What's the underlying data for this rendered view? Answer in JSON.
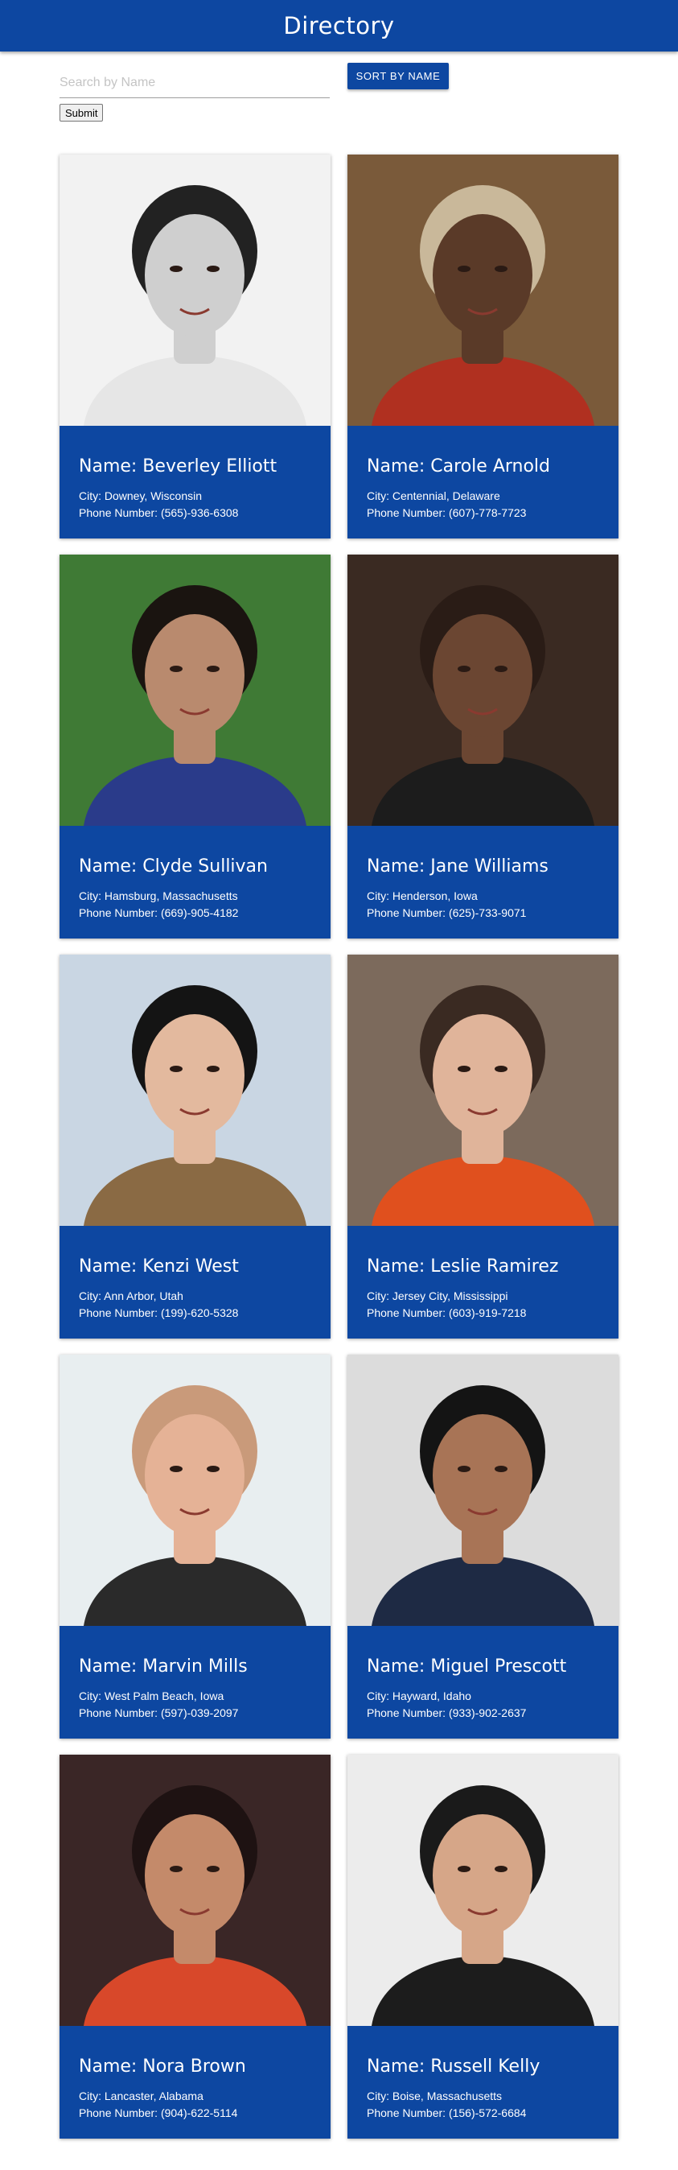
{
  "header": {
    "title": "Directory"
  },
  "search": {
    "placeholder": "Search by Name",
    "value": "",
    "submit_label": "Submit"
  },
  "sort": {
    "label": "SORT BY NAME"
  },
  "colors": {
    "brand": "#0d47a1",
    "page_bg": "#ffffff"
  },
  "people": [
    {
      "name": "Name: Beverley Elliott",
      "city": "City: Downey, Wisconsin",
      "phone": "Phone Number: (565)-936-6308",
      "photo": {
        "bg": "#f2f2f2",
        "skin": "#cfcfcf",
        "hair": "#222222",
        "shirt": "#e6e6e6"
      }
    },
    {
      "name": "Name: Carole Arnold",
      "city": "City: Centennial, Delaware",
      "phone": "Phone Number: (607)-778-7723",
      "photo": {
        "bg": "#7a5a3a",
        "skin": "#5a3a28",
        "hair": "#c9b89a",
        "shirt": "#b03020"
      }
    },
    {
      "name": "Name: Clyde Sullivan",
      "city": "City: Hamsburg, Massachusetts",
      "phone": "Phone Number: (669)-905-4182",
      "photo": {
        "bg": "#3f7a35",
        "skin": "#b98a6e",
        "hair": "#1a1410",
        "shirt": "#2a3b8a"
      }
    },
    {
      "name": "Name: Jane Williams",
      "city": "City: Henderson, Iowa",
      "phone": "Phone Number: (625)-733-9071",
      "photo": {
        "bg": "#3a2a22",
        "skin": "#6b4632",
        "hair": "#2a1c16",
        "shirt": "#1c1c1c"
      }
    },
    {
      "name": "Name: Kenzi West",
      "city": "City: Ann Arbor, Utah",
      "phone": "Phone Number: (199)-620-5328",
      "photo": {
        "bg": "#c9d6e3",
        "skin": "#e3b99e",
        "hair": "#141414",
        "shirt": "#8a6a44"
      }
    },
    {
      "name": "Name: Leslie Ramirez",
      "city": "City: Jersey City, Mississippi",
      "phone": "Phone Number: (603)-919-7218",
      "photo": {
        "bg": "#7c6a5c",
        "skin": "#e0b49a",
        "hair": "#3a2a22",
        "shirt": "#e0501e"
      }
    },
    {
      "name": "Name: Marvin Mills",
      "city": "City: West Palm Beach, Iowa",
      "phone": "Phone Number: (597)-039-2097",
      "photo": {
        "bg": "#e8eef0",
        "skin": "#e5b296",
        "hair": "#c99a7a",
        "shirt": "#2a2a2a"
      }
    },
    {
      "name": "Name: Miguel Prescott",
      "city": "City: Hayward, Idaho",
      "phone": "Phone Number: (933)-902-2637",
      "photo": {
        "bg": "#dcdcdc",
        "skin": "#a87456",
        "hair": "#141414",
        "shirt": "#1e2a44"
      }
    },
    {
      "name": "Name: Nora Brown",
      "city": "City: Lancaster, Alabama",
      "phone": "Phone Number: (904)-622-5114",
      "photo": {
        "bg": "#3a2626",
        "skin": "#c48a6a",
        "hair": "#1e1212",
        "shirt": "#d8482a"
      }
    },
    {
      "name": "Name: Russell Kelly",
      "city": "City: Boise, Massachusetts",
      "phone": "Phone Number: (156)-572-6684",
      "photo": {
        "bg": "#ececec",
        "skin": "#d6a688",
        "hair": "#1a1a1a",
        "shirt": "#1c1c1c"
      }
    }
  ]
}
